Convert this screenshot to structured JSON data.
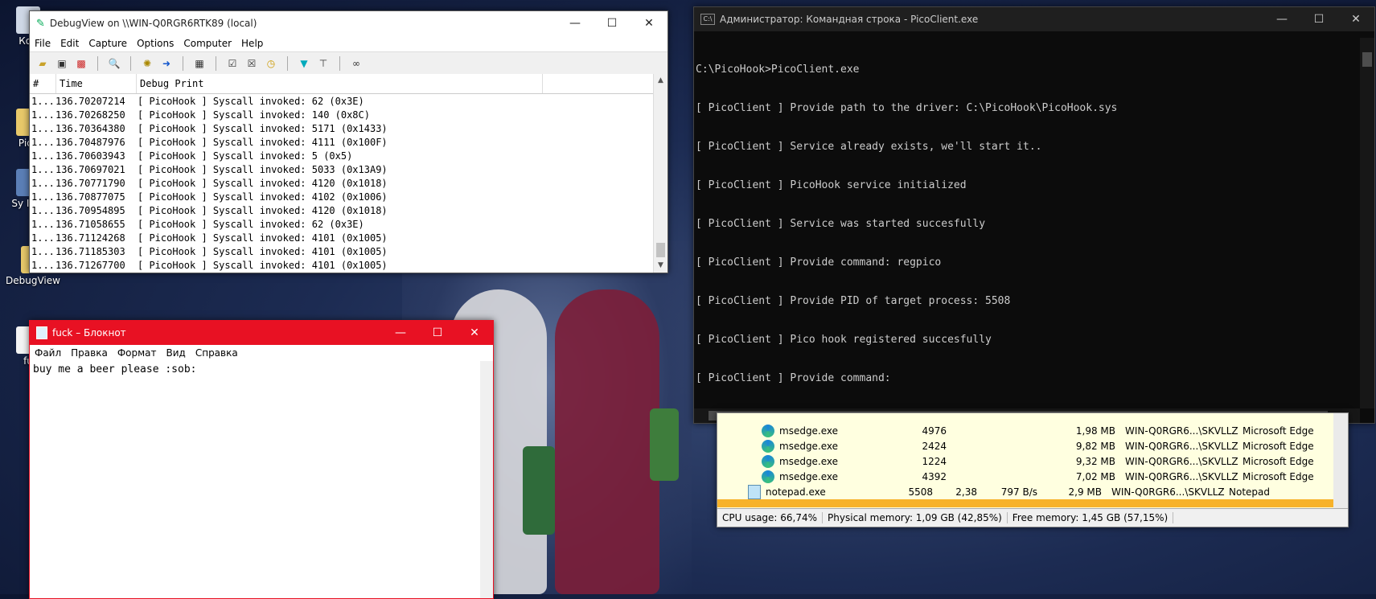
{
  "desktop": {
    "icons": [
      {
        "label": "Кор",
        "icon": "computer-icon"
      },
      {
        "label": "Pico",
        "icon": "folder-icon"
      },
      {
        "label": "Sy Info",
        "icon": "sysinfo-icon"
      },
      {
        "label": "DebugView",
        "icon": "folder-icon"
      },
      {
        "label": "fu",
        "icon": "text-file-icon"
      }
    ]
  },
  "debugview": {
    "title": "DebugView on \\\\WIN-Q0RGR6RTK89 (local)",
    "menu": [
      "File",
      "Edit",
      "Capture",
      "Options",
      "Computer",
      "Help"
    ],
    "columns": {
      "num": "#",
      "time": "Time",
      "msg": "Debug Print"
    },
    "rows": [
      {
        "num": "1...",
        "time": "136.70207214",
        "msg": "[ PicoHook ] Syscall invoked: 62 (0x3E)"
      },
      {
        "num": "1...",
        "time": "136.70268250",
        "msg": "[ PicoHook ] Syscall invoked: 140 (0x8C)"
      },
      {
        "num": "1...",
        "time": "136.70364380",
        "msg": "[ PicoHook ] Syscall invoked: 5171 (0x1433)"
      },
      {
        "num": "1...",
        "time": "136.70487976",
        "msg": "[ PicoHook ] Syscall invoked: 4111 (0x100F)"
      },
      {
        "num": "1...",
        "time": "136.70603943",
        "msg": "[ PicoHook ] Syscall invoked: 5 (0x5)"
      },
      {
        "num": "1...",
        "time": "136.70697021",
        "msg": "[ PicoHook ] Syscall invoked: 5033 (0x13A9)"
      },
      {
        "num": "1...",
        "time": "136.70771790",
        "msg": "[ PicoHook ] Syscall invoked: 4120 (0x1018)"
      },
      {
        "num": "1...",
        "time": "136.70877075",
        "msg": "[ PicoHook ] Syscall invoked: 4102 (0x1006)"
      },
      {
        "num": "1...",
        "time": "136.70954895",
        "msg": "[ PicoHook ] Syscall invoked: 4120 (0x1018)"
      },
      {
        "num": "1...",
        "time": "136.71058655",
        "msg": "[ PicoHook ] Syscall invoked: 62 (0x3E)"
      },
      {
        "num": "1...",
        "time": "136.71124268",
        "msg": "[ PicoHook ] Syscall invoked: 4101 (0x1005)"
      },
      {
        "num": "1...",
        "time": "136.71185303",
        "msg": "[ PicoHook ] Syscall invoked: 4101 (0x1005)"
      },
      {
        "num": "1...",
        "time": "136.71267700",
        "msg": "[ PicoHook ] Syscall invoked: 4101 (0x1005)"
      }
    ]
  },
  "cmd": {
    "title": "Администратор: Командная строка - PicoClient.exe",
    "lines": [
      "C:\\PicoHook>PicoClient.exe",
      "[ PicoClient ] Provide path to the driver: C:\\PicoHook\\PicoHook.sys",
      "[ PicoClient ] Service already exists, we'll start it..",
      "[ PicoClient ] PicoHook service initialized",
      "[ PicoClient ] Service was started succesfully",
      "[ PicoClient ] Provide command: regpico",
      "[ PicoClient ] Provide PID of target process: 5508",
      "[ PicoClient ] Pico hook registered succesfully",
      "[ PicoClient ] Provide command:"
    ]
  },
  "procexp": {
    "rows": [
      {
        "name": "msedge.exe",
        "pid": "4976",
        "cpu": "",
        "io": "",
        "mem": "1,98 MB",
        "user": "WIN-Q0RGR6...\\SKVLLZ",
        "desc": "Microsoft Edge",
        "icon": "edge-icon"
      },
      {
        "name": "msedge.exe",
        "pid": "2424",
        "cpu": "",
        "io": "",
        "mem": "9,82 MB",
        "user": "WIN-Q0RGR6...\\SKVLLZ",
        "desc": "Microsoft Edge",
        "icon": "edge-icon"
      },
      {
        "name": "msedge.exe",
        "pid": "1224",
        "cpu": "",
        "io": "",
        "mem": "9,32 MB",
        "user": "WIN-Q0RGR6...\\SKVLLZ",
        "desc": "Microsoft Edge",
        "icon": "edge-icon"
      },
      {
        "name": "msedge.exe",
        "pid": "4392",
        "cpu": "",
        "io": "",
        "mem": "7,02 MB",
        "user": "WIN-Q0RGR6...\\SKVLLZ",
        "desc": "Microsoft Edge",
        "icon": "edge-icon"
      },
      {
        "name": "notepad.exe",
        "pid": "5508",
        "cpu": "2,38",
        "io": "797 B/s",
        "mem": "2,9 MB",
        "user": "WIN-Q0RGR6...\\SKVLLZ",
        "desc": "Notepad",
        "icon": "notepad-icon"
      }
    ],
    "status": {
      "cpu": "CPU usage: 66,74%",
      "physical": "Physical memory: 1,09 GB (42,85%)",
      "free": "Free memory: 1,45 GB (57,15%)"
    }
  },
  "notepad": {
    "title": "fuck – Блокнот",
    "menu": [
      "Файл",
      "Правка",
      "Формат",
      "Вид",
      "Справка"
    ],
    "content": "buy me a beer please :sob:"
  }
}
